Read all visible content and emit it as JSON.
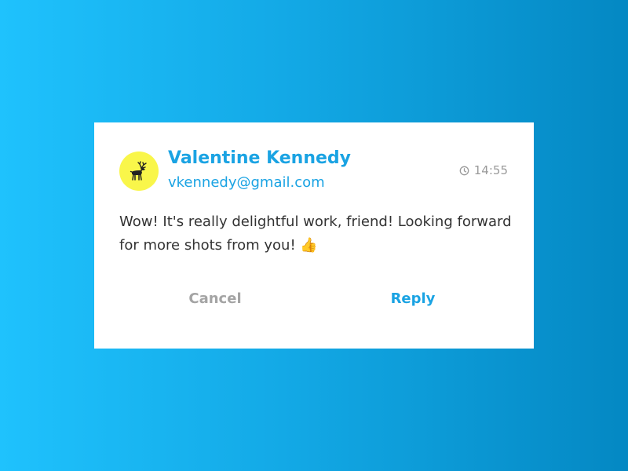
{
  "card": {
    "sender_name": "Valentine Kennedy",
    "sender_email": "vkennedy@gmail.com",
    "time": "14:55",
    "message": "Wow! It's really delightful work, friend! Looking forward for more shots from you! 👍",
    "avatar_icon": "deer-icon",
    "clock_icon": "clock-icon"
  },
  "actions": {
    "cancel_label": "Cancel",
    "reply_label": "Reply"
  },
  "colors": {
    "accent": "#1aa3e3",
    "avatar_bg": "#f9f64a",
    "muted": "#a4a4a4",
    "background_start": "#1fc2fd",
    "background_end": "#0488c3"
  }
}
